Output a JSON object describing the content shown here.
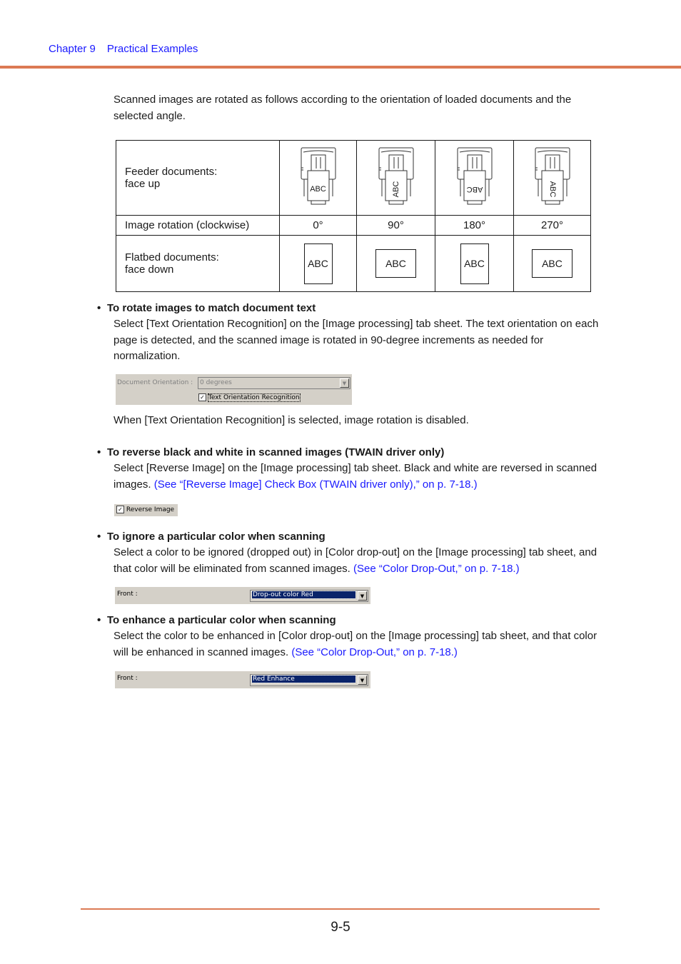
{
  "header": {
    "chapter": "Chapter 9",
    "title": "Practical Examples"
  },
  "intro": "Scanned images are rotated as follows according to the orientation of loaded documents and the selected angle.",
  "table": {
    "feeder_label_line1": "Feeder documents:",
    "feeder_label_line2": "face up",
    "rotation_label": "Image rotation (clockwise)",
    "flatbed_label_line1": "Flatbed documents:",
    "flatbed_label_line2": "face down",
    "doc_text": "ABC",
    "angles": [
      "0°",
      "90°",
      "180°",
      "270°"
    ]
  },
  "sections": [
    {
      "heading": "To rotate images to match document text",
      "body": "Select [Text Orientation Recognition] on the [Image processing] tab sheet. The text orientation on each page is detected, and the scanned image is rotated in 90-degree increments as needed for normalization.",
      "note": "When [Text Orientation Recognition] is selected, image rotation is disabled."
    },
    {
      "heading": "To reverse black and white in scanned images (TWAIN driver only)",
      "body": "Select [Reverse Image] on the [Image processing] tab sheet. Black and white are reversed in scanned images.",
      "link": "(See “[Reverse Image] Check Box (TWAIN driver only),” on p. 7-18.)"
    },
    {
      "heading": "To ignore a particular color when scanning",
      "body": "Select a color to be ignored (dropped out) in [Color drop-out] on the [Image processing] tab sheet, and that color will be eliminated from scanned images.",
      "link": "(See “Color Drop-Out,” on p. 7-18.)"
    },
    {
      "heading": "To enhance a particular color when scanning",
      "body": "Select the color to be enhanced in [Color drop-out] on the [Image processing] tab sheet, and that color will be enhanced in scanned images.",
      "link": "(See “Color Drop-Out,” on p. 7-18.)"
    }
  ],
  "screenshots": {
    "orientation_label": "Document Orientation :",
    "orientation_value": "0 degrees",
    "text_orientation_checkbox": "Text Orientation Recognition",
    "reverse_image_checkbox": "Reverse Image",
    "front_label": "Front :",
    "dropout_value": "Drop-out color Red",
    "enhance_value": "Red Enhance"
  },
  "page_number": "9-5"
}
